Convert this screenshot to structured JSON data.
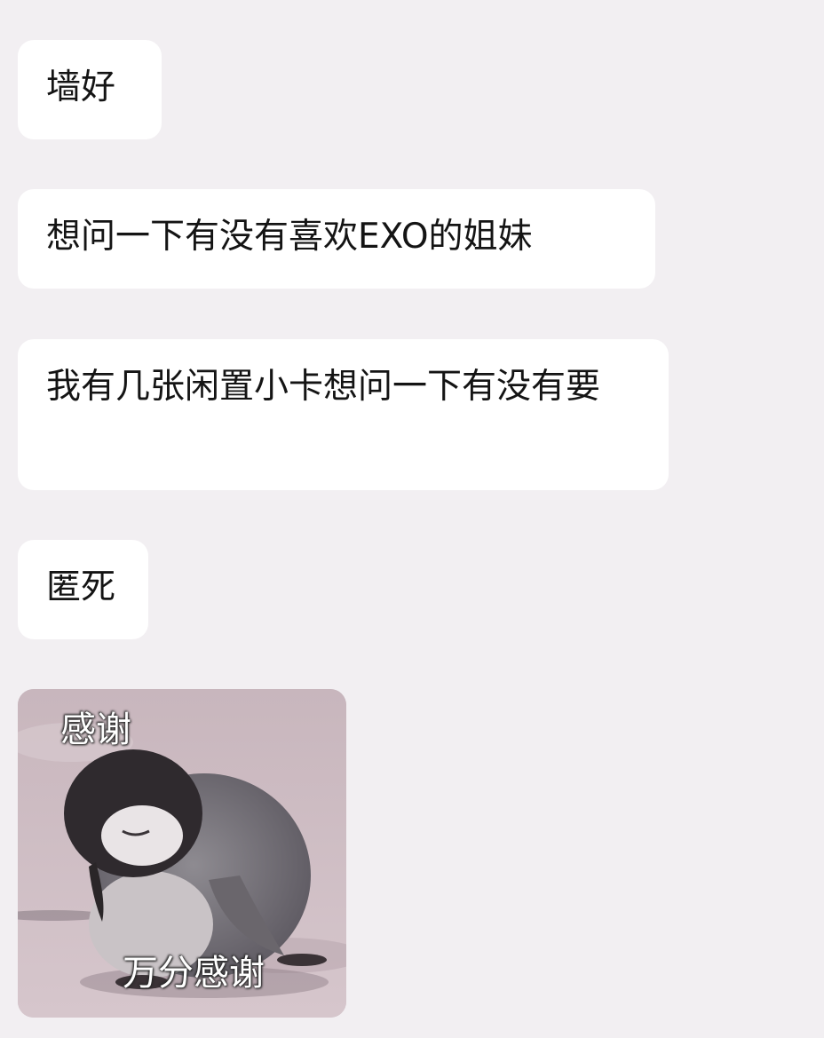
{
  "messages": [
    {
      "text": "墙好"
    },
    {
      "text": "想问一下有没有喜欢EXO的姐妹"
    },
    {
      "text": "我有几张闲置小卡想问一下有没有要"
    },
    {
      "text": "匿死"
    }
  ],
  "sticker": {
    "caption_top": "感谢",
    "caption_bottom": "万分感谢",
    "subject": "penguin-chick"
  },
  "colors": {
    "background": "#f2eff2",
    "bubble": "#ffffff",
    "text": "#141414"
  }
}
